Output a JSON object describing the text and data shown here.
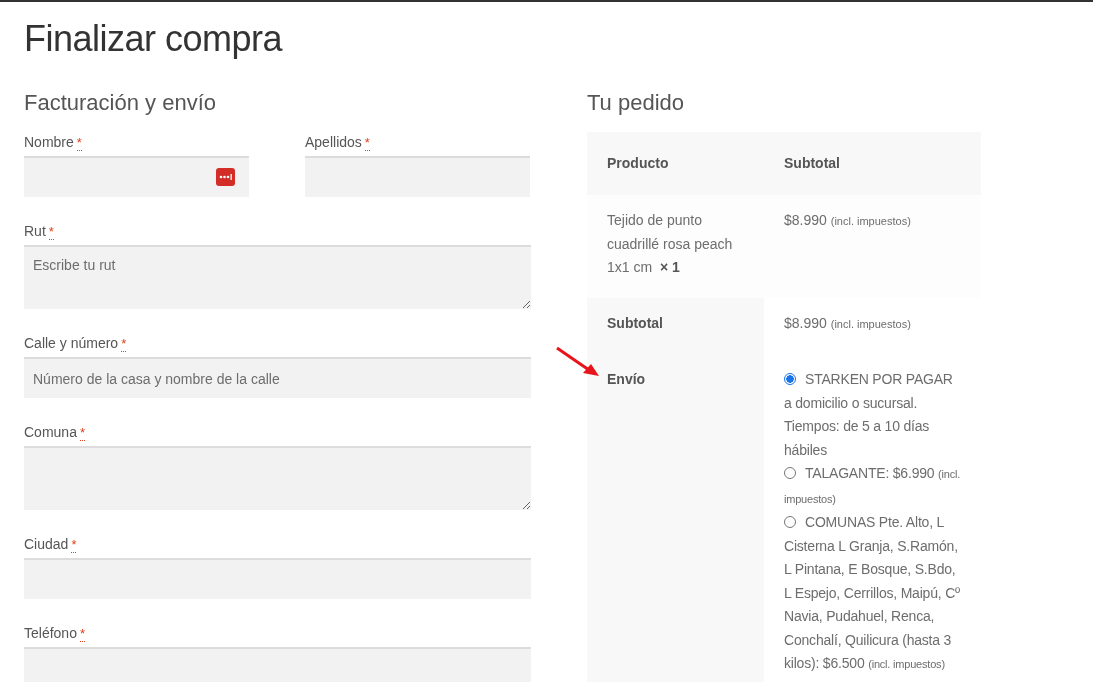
{
  "page_title": "Finalizar compra",
  "billing": {
    "heading": "Facturación y envío",
    "rows": [
      [
        {
          "label": "Nombre",
          "required_mark": "*",
          "kind": "text",
          "autofill_icon": true
        },
        {
          "label": "Apellidos",
          "required_mark": "*",
          "kind": "text",
          "autofill_icon": false
        }
      ],
      [
        {
          "label": "Rut",
          "required_mark": "*",
          "kind": "textarea",
          "placeholder": "Escribe tu rut"
        }
      ],
      [
        {
          "label": "Calle y número",
          "required_mark": "*",
          "kind": "text",
          "placeholder": "Número de la casa y nombre de la calle"
        }
      ],
      [
        {
          "label": "Comuna",
          "required_mark": "*",
          "kind": "textarea"
        }
      ],
      [
        {
          "label": "Ciudad",
          "required_mark": "*",
          "kind": "text"
        }
      ],
      [
        {
          "label": "Teléfono",
          "required_mark": "*",
          "kind": "text"
        }
      ]
    ]
  },
  "order": {
    "heading": "Tu pedido",
    "columns": [
      "Producto",
      "Subtotal"
    ],
    "items": [
      {
        "name": "Tejido de punto cuadrillé rosa peach 1x1 cm",
        "quantity": "× 1",
        "price": "$8.990",
        "tax_note": "(incl. impuestos)"
      }
    ],
    "subtotal": {
      "label": "Subtotal",
      "price": "$8.990",
      "tax_note": "(incl. impuestos)"
    },
    "shipping": {
      "label": "Envío",
      "options": [
        {
          "selected": true,
          "text": "STARKEN POR PAGAR a domicilio o sucursal. Tiempos: de 5 a 10 días hábiles"
        },
        {
          "selected": false,
          "text": "TALAGANTE: $6.990",
          "tax_note": "(incl. impuestos)"
        },
        {
          "selected": false,
          "text": "COMUNAS Pte. Alto, L Cisterna L Granja, S.Ramón, L Pintana, E Bosque, S.Bdo, L Espejo, Cerrillos, Maipú, Cº Navia, Pudahuel, Renca, Conchalí, Quilicura (hasta 3 kilos): $6.500",
          "tax_note": "(incl. impuestos)"
        }
      ]
    }
  }
}
